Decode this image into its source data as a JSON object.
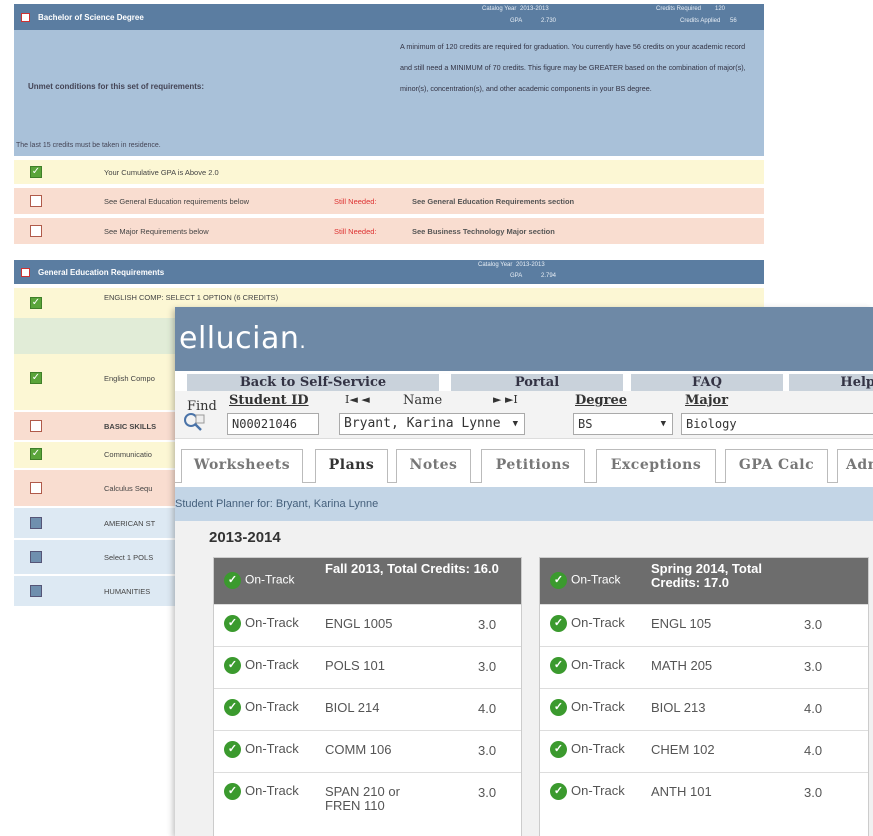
{
  "degree": {
    "title": "Bachelor of Science Degree",
    "catalog_label": "Catalog Year",
    "catalog_value": "2013-2013",
    "credits_req_label": "Credits Required",
    "credits_req_value": "120",
    "gpa_label": "GPA",
    "gpa_value": "2.730",
    "credits_applied_label": "Credits Applied",
    "credits_applied_value": "56",
    "unmet": "Unmet conditions for this set of requirements:",
    "residence": "The last 15 credits must be taken in residence.",
    "message": "A minimum of 120 credits are required for graduation. You currently have 56 credits on your academic record and still need a MINIMUM of 70 credits. This figure may be GREATER based on the combination of major(s), minor(s), concentration(s), and other academic components in your BS degree.",
    "rows": [
      {
        "label": "Your Cumulative GPA is Above 2.0",
        "needed": "",
        "see": ""
      },
      {
        "label": "See General Education requirements below",
        "needed": "Still Needed:",
        "see": "See General Education Requirements section"
      },
      {
        "label": "See Major Requirements below",
        "needed": "Still Needed:",
        "see": "See Business Technology Major section"
      }
    ]
  },
  "gened": {
    "title": "General Education Requirements",
    "catalog_label": "Catalog Year",
    "catalog_value": "2013-2013",
    "gpa_label": "GPA",
    "gpa_value": "2.794",
    "rows": [
      "ENGLISH COMP: SELECT 1 OPTION (6 CREDITS)",
      "",
      "English Compo",
      "BASIC SKILLS",
      "Communicatio",
      "Calculus Sequ",
      "AMERICAN ST",
      "Select 1 POLS",
      "HUMANITIES"
    ]
  },
  "app": {
    "logo": "ellucian",
    "logo_dot": ".",
    "nav": [
      "Back to Self-Service",
      "Portal",
      "FAQ",
      "Help"
    ],
    "find_label": "Find",
    "student_id_label": "Student ID",
    "student_id_value": "N00021046",
    "name_label": "Name",
    "name_value": "Bryant, Karina Lynne",
    "degree_label": "Degree",
    "degree_value": "BS",
    "major_label": "Major",
    "major_value": "Biology",
    "pager_first": "I◄ ◄",
    "pager_last": "► ►I",
    "tabs": [
      "Worksheets",
      "Plans",
      "Notes",
      "Petitions",
      "Exceptions",
      "GPA Calc",
      "Adm"
    ],
    "subhead": "Student Planner for: Bryant, Karina Lynne",
    "year": "2013-2014",
    "terms": [
      {
        "status": "On-Track",
        "name": "Fall 2013, Total Credits: 16.0",
        "courses": [
          {
            "status": "On-Track",
            "course": "ENGL 1005",
            "credits": "3.0"
          },
          {
            "status": "On-Track",
            "course": "POLS 101",
            "credits": "3.0"
          },
          {
            "status": "On-Track",
            "course": "BIOL 214",
            "credits": "4.0"
          },
          {
            "status": "On-Track",
            "course": "COMM 106",
            "credits": "3.0"
          },
          {
            "status": "On-Track",
            "course": "SPAN 210 or FREN 110",
            "credits": "3.0"
          }
        ]
      },
      {
        "status": "On-Track",
        "name": "Spring 2014, Total Credits: 17.0",
        "courses": [
          {
            "status": "On-Track",
            "course": "ENGL 105",
            "credits": "3.0"
          },
          {
            "status": "On-Track",
            "course": "MATH 205",
            "credits": "3.0"
          },
          {
            "status": "On-Track",
            "course": "BIOL 213",
            "credits": "4.0"
          },
          {
            "status": "On-Track",
            "course": "CHEM 102",
            "credits": "4.0"
          },
          {
            "status": "On-Track",
            "course": "ANTH 101",
            "credits": "3.0"
          }
        ]
      }
    ]
  }
}
